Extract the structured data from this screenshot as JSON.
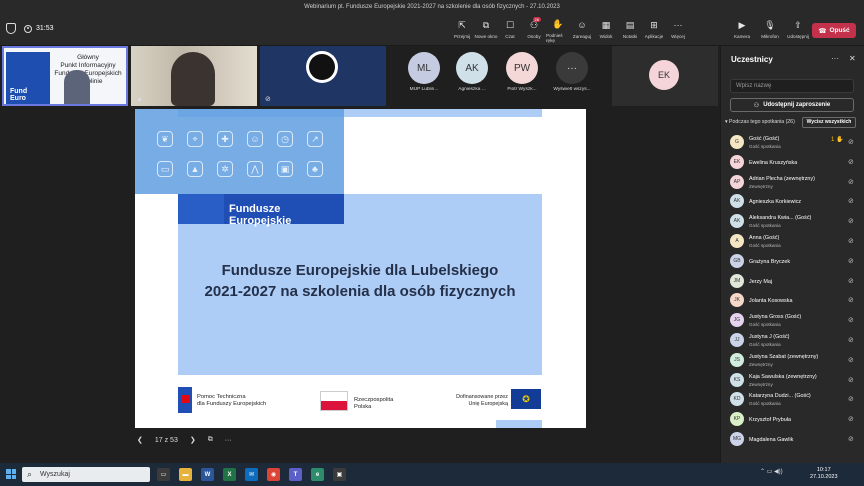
{
  "window": {
    "title": "Webinarium pt. Fundusze Europejskie 2021-2027 na szkolenie dla osób fizycznych - 27.10.2023"
  },
  "toolbar": {
    "timer": "31:53",
    "buttons": [
      {
        "label": "Przejmij",
        "icon": "⇱"
      },
      {
        "label": "Nowe okno",
        "icon": "⧉"
      },
      {
        "label": "Czat",
        "icon": "☐"
      },
      {
        "label": "Osoby",
        "icon": "⚇",
        "badge": "26"
      },
      {
        "label": "Podnieś rękę",
        "icon": "✋"
      },
      {
        "label": "Zareaguj",
        "icon": "☺"
      },
      {
        "label": "Widok",
        "icon": "▦"
      },
      {
        "label": "Notatki",
        "icon": "▤"
      },
      {
        "label": "Aplikacje",
        "icon": "⊞"
      },
      {
        "label": "Więcej",
        "icon": "···"
      }
    ],
    "camera": "Kamera",
    "mic": "Mikrofon",
    "share": "Udostępnij",
    "leave": "Opuść"
  },
  "tiles": {
    "t1_caption_l1": "Główny",
    "t1_caption_l2": "Punkt Informacyjny",
    "t1_caption_l3": "Funduszy Europejskich",
    "t1_caption_l4": "w Lublinie",
    "t1_doc_l1": "Fund",
    "t1_doc_l2": "Euro",
    "avatars": [
      {
        "initials": "ML",
        "name": "MUP Lublin...",
        "color": "#c5cbe0"
      },
      {
        "initials": "AK",
        "name": "Agnieszka ...",
        "color": "#cfe0e9"
      },
      {
        "initials": "PW",
        "name": "Piotr Wyszk...",
        "color": "#f4d7d7"
      },
      {
        "initials": "···",
        "name": "Wyświetl wszys...",
        "color": "#3a3a3a"
      }
    ],
    "ek": "EK"
  },
  "slide": {
    "fe_label": "Fundusze Europejskie",
    "title_l1": "Fundusze Europejskie dla Lubelskiego",
    "title_l2": "2021-2027 na szkolenia dla osób fizycznych",
    "pt_l1": "Pomoc Techniczna",
    "pt_l2": "dla Funduszy Europejskich",
    "pl_l1": "Rzeczpospolita",
    "pl_l2": "Polska",
    "ue_l1": "Dofinansowane przez",
    "ue_l2": "Unię Europejską",
    "page": "17 z 53"
  },
  "panel": {
    "title": "Uczestnicy",
    "search_placeholder": "Wpisz nazwę",
    "share_invite": "Udostępnij zaproszenie",
    "section": "Podczas tego spotkania (26)",
    "mute_all": "Wycisz wszystkich",
    "participants": [
      {
        "init": "G",
        "name": "Gość (Gość)",
        "role": "Gość spotkania",
        "color": "#f5e7c3",
        "hand": "1 ✋"
      },
      {
        "init": "EK",
        "name": "Ewelina Kruszyńska",
        "role": "",
        "color": "#f5d5d9"
      },
      {
        "init": "AP",
        "name": "Adrian Plecha (zewnętrzny)",
        "role": "Zewnętrzny",
        "color": "#f5d5d9"
      },
      {
        "init": "AK",
        "name": "Agnieszka Korkiewicz",
        "role": "",
        "color": "#cfe0e9"
      },
      {
        "init": "AK",
        "name": "Aleksandra Kwia... (Gość)",
        "role": "Gość spotkania",
        "color": "#cfe0e9"
      },
      {
        "init": "A",
        "name": "Anna (Gość)",
        "role": "Gość spotkania",
        "color": "#f5e7c3"
      },
      {
        "init": "GB",
        "name": "Grażyna Bryczek",
        "role": "",
        "color": "#cbd3e8"
      },
      {
        "init": "JM",
        "name": "Jerzy Maj",
        "role": "",
        "color": "#e0e7d8"
      },
      {
        "init": "JK",
        "name": "Jolanta Kosowska",
        "role": "",
        "color": "#f5d8c8"
      },
      {
        "init": "JG",
        "name": "Justyna Gross (Gość)",
        "role": "Gość spotkania",
        "color": "#e6d3ef"
      },
      {
        "init": "JJ",
        "name": "Justyna J (Gość)",
        "role": "Gość spotkania",
        "color": "#cbd3e8"
      },
      {
        "init": "JS",
        "name": "Justyna Szabat (zewnętrzny)",
        "role": "Zewnętrzny",
        "color": "#d2ece0"
      },
      {
        "init": "KS",
        "name": "Kaja Sawulska (zewnętrzny)",
        "role": "Zewnętrzny",
        "color": "#cfe0e9"
      },
      {
        "init": "KD",
        "name": "Katarzyna Dudzi... (Gość)",
        "role": "Gość spotkania",
        "color": "#cfe0e9"
      },
      {
        "init": "KP",
        "name": "Krzysztof Prybuła",
        "role": "",
        "color": "#d9efc8"
      },
      {
        "init": "MG",
        "name": "Magdalena Gawlik",
        "role": "",
        "color": "#cbd3e8"
      }
    ]
  },
  "taskbar": {
    "search": "Wyszukaj",
    "time": "10:17",
    "date": "27.10.2023"
  }
}
